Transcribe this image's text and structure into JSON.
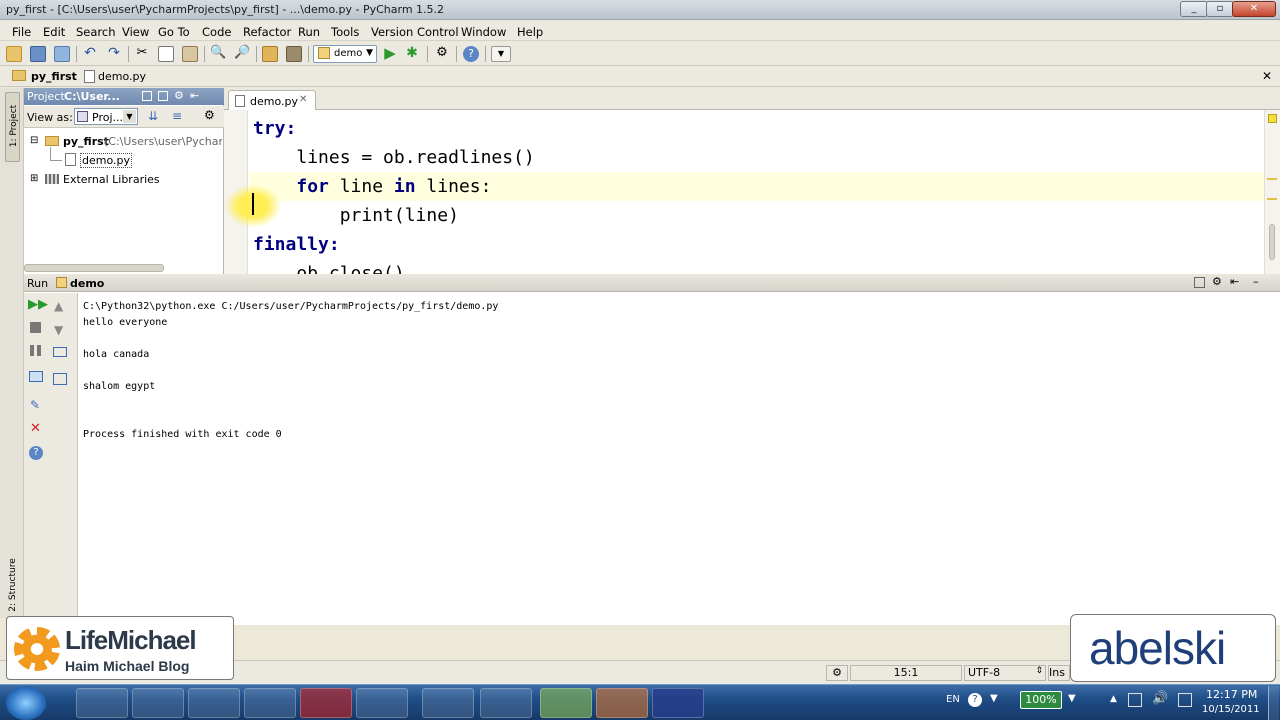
{
  "window": {
    "title": "py_first - [C:\\Users\\user\\PycharmProjects\\py_first] - ...\\demo.py - PyCharm 1.5.2"
  },
  "menu": [
    "File",
    "Edit",
    "Search",
    "View",
    "Go To",
    "Code",
    "Refactor",
    "Run",
    "Tools",
    "Version Control",
    "Window",
    "Help"
  ],
  "toolbar": {
    "run_config": "demo"
  },
  "breadcrumb": {
    "project": "py_first",
    "file": "demo.py"
  },
  "left_tools": {
    "project_tab": "1: Project",
    "structure_tab": "2: Structure"
  },
  "project_pane": {
    "header": "Project",
    "header_path": "C:\\User...",
    "view_as_label": "View as:",
    "view_as_value": "Proj...",
    "tree": {
      "root_name": "py_first",
      "root_path": "(C:\\Users\\user\\Pycharm",
      "file": "demo.py",
      "libraries": "External Libraries"
    }
  },
  "editor": {
    "tab": "demo.py",
    "lines": [
      {
        "indent": "",
        "tokens": [
          {
            "t": "try",
            "kw": true
          },
          {
            "t": ":",
            "kw": true
          }
        ]
      },
      {
        "indent": "    ",
        "tokens": [
          {
            "t": "lines = ob.readlines()",
            "kw": false
          }
        ]
      },
      {
        "indent": "    ",
        "tokens": [
          {
            "t": "for",
            "kw": true
          },
          {
            "t": " line ",
            "kw": false
          },
          {
            "t": "in",
            "kw": true
          },
          {
            "t": " lines:",
            "kw": false
          }
        ]
      },
      {
        "indent": "        ",
        "tokens": [
          {
            "t": "print(line)",
            "kw": false
          }
        ]
      },
      {
        "indent": "",
        "tokens": [
          {
            "t": "finally",
            "kw": true
          },
          {
            "t": ":",
            "kw": true
          }
        ]
      },
      {
        "indent": "    ",
        "tokens": [
          {
            "t": "ob.close()",
            "kw": false
          }
        ]
      }
    ]
  },
  "run_pane": {
    "label": "Run",
    "config": "demo",
    "output": [
      "C:\\Python32\\python.exe C:/Users/user/PycharmProjects/py_first/demo.py",
      "hello everyone",
      "",
      "hola canada",
      "",
      "shalom egypt",
      "",
      "",
      "Process finished with exit code 0"
    ]
  },
  "status_bar": {
    "position": "15:1",
    "encoding": "UTF-8",
    "mode": "Ins"
  },
  "taskbar": {
    "lang": "EN",
    "zoom": "100%",
    "time": "12:17 PM",
    "date": "10/15/2011"
  },
  "watermarks": {
    "left_title": "LifeMichael",
    "left_subtitle": "Haim Michael Blog",
    "right": "abelski"
  },
  "colors": {
    "keyword": "#000080",
    "caret_line": "#ffffe0",
    "accent_green": "#2a9a2a"
  }
}
